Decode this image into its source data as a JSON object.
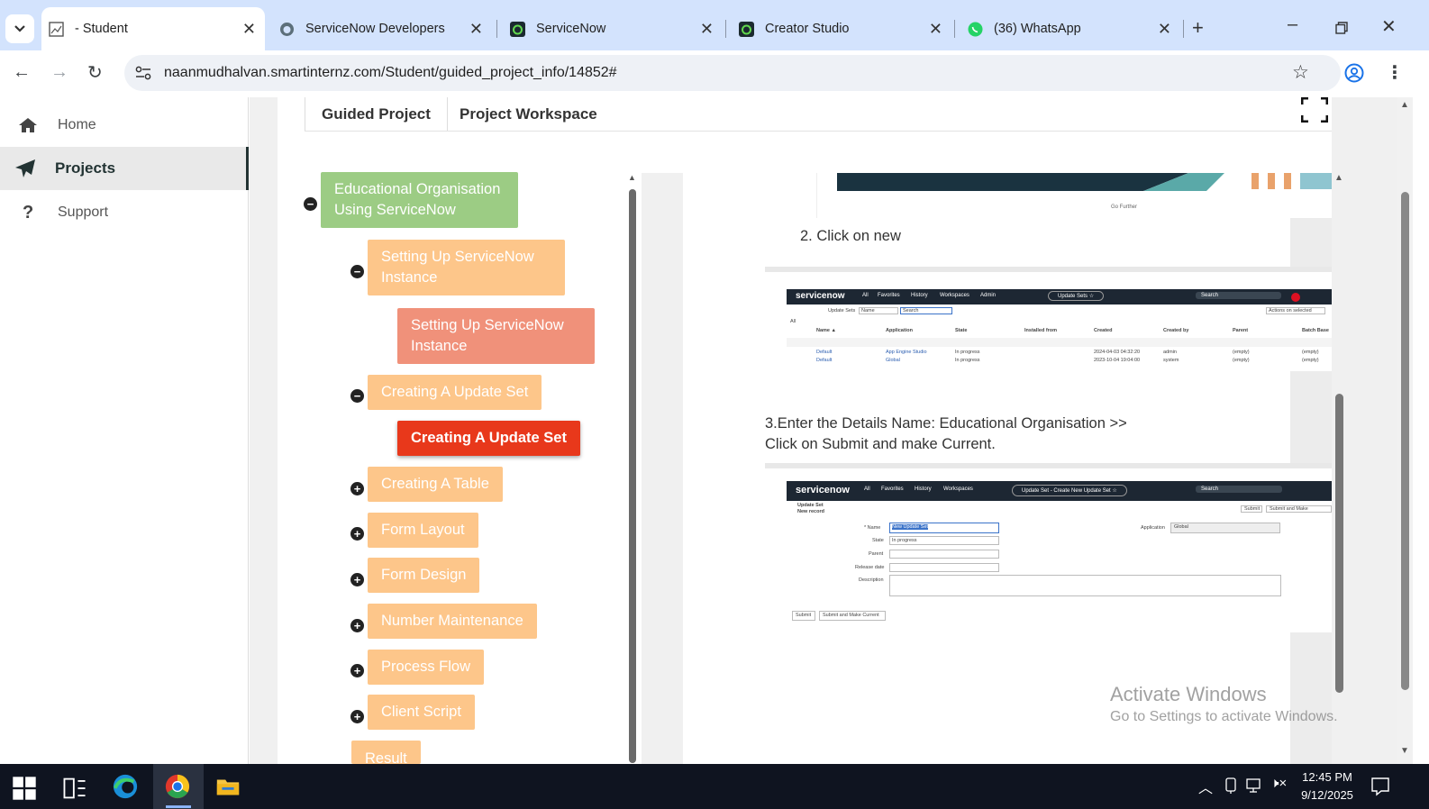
{
  "browser": {
    "tabs": [
      {
        "title": "- Student",
        "active": true
      },
      {
        "title": "ServiceNow Developers",
        "active": false
      },
      {
        "title": "ServiceNow",
        "active": false
      },
      {
        "title": "Creator Studio",
        "active": false
      },
      {
        "title": "(36) WhatsApp",
        "active": false
      }
    ],
    "url": "naanmudhalvan.smartinternz.com/Student/guided_project_info/14852#"
  },
  "sidebar": {
    "items": [
      {
        "label": "Home",
        "icon": "home-icon",
        "active": false
      },
      {
        "label": "Projects",
        "icon": "paper-plane-icon",
        "active": true
      },
      {
        "label": "Support",
        "icon": "question-icon",
        "active": false
      }
    ]
  },
  "page_tabs": {
    "guided": "Guided Project",
    "workspace": "Project Workspace"
  },
  "tree": {
    "root": "Educational Organisation Using ServiceNow",
    "n1": "Setting Up ServiceNow Instance",
    "n1_child": "Setting Up ServiceNow Instance",
    "n2": "Creating A Update Set",
    "n2_child": "Creating A Update Set",
    "n3": "Creating A Table",
    "n4": "Form Layout",
    "n5": "Form Design",
    "n6": "Number Maintenance",
    "n7": "Process Flow",
    "n8": "Client Script",
    "n9": "Result"
  },
  "doc": {
    "go_further": "Go Further",
    "step2": "2. Click on new",
    "step3_line1": "3.Enter the Details Name: Educational Organisation >>",
    "step3_line2": "Click on Submit and make Current."
  },
  "shot1": {
    "logo": "servicenow",
    "nav": [
      "All",
      "Favorites",
      "History",
      "Workspaces",
      "Admin"
    ],
    "title_pill": "Update Sets ☆",
    "search": "Search",
    "filter_label": "Update Sets",
    "filter_field": "Name",
    "filter_search": "Search",
    "actions": "Actions on selected",
    "all_label": "All",
    "columns": [
      "Name ▲",
      "Application",
      "State",
      "Installed from",
      "Created",
      "Created by",
      "Parent",
      "Batch Base"
    ],
    "rows": [
      [
        "Default",
        "App Engine Studio",
        "In progress",
        "",
        "2024-04-03 04:32:20",
        "admin",
        "(empty)",
        "(empty)"
      ],
      [
        "Default",
        "Global",
        "In progress",
        "",
        "2023-10-04 19:04:00",
        "system",
        "(empty)",
        "(empty)"
      ]
    ]
  },
  "shot2": {
    "logo": "servicenow",
    "nav": [
      "All",
      "Favorites",
      "History",
      "Workspaces"
    ],
    "title_pill": "Update Set - Create New Update Set ☆",
    "search": "Search",
    "header_line1": "Update Set",
    "header_line2": "New record",
    "btn_submit": "Submit",
    "btn_submit_make": "Submit and Make",
    "labels": {
      "name": "* Name",
      "state": "State",
      "parent": "Parent",
      "release": "Release date",
      "desc": "Description",
      "application": "Application"
    },
    "values": {
      "name": "New Update Set",
      "state": "In progress",
      "application": "Global"
    },
    "footer_submit": "Submit",
    "footer_submit_make": "Submit and Make Current"
  },
  "watermark": {
    "line1": "Activate Windows",
    "line2": "Go to Settings to activate Windows."
  },
  "taskbar": {
    "time": "12:45 PM",
    "date": "9/12/2025"
  },
  "colors": {
    "tabstrip": "#d3e3fd",
    "node_green": "#9ccc84",
    "node_orange": "#fdc68a",
    "node_salmon": "#f0917a",
    "node_active": "#e8381b",
    "taskbar": "#0f1420"
  }
}
